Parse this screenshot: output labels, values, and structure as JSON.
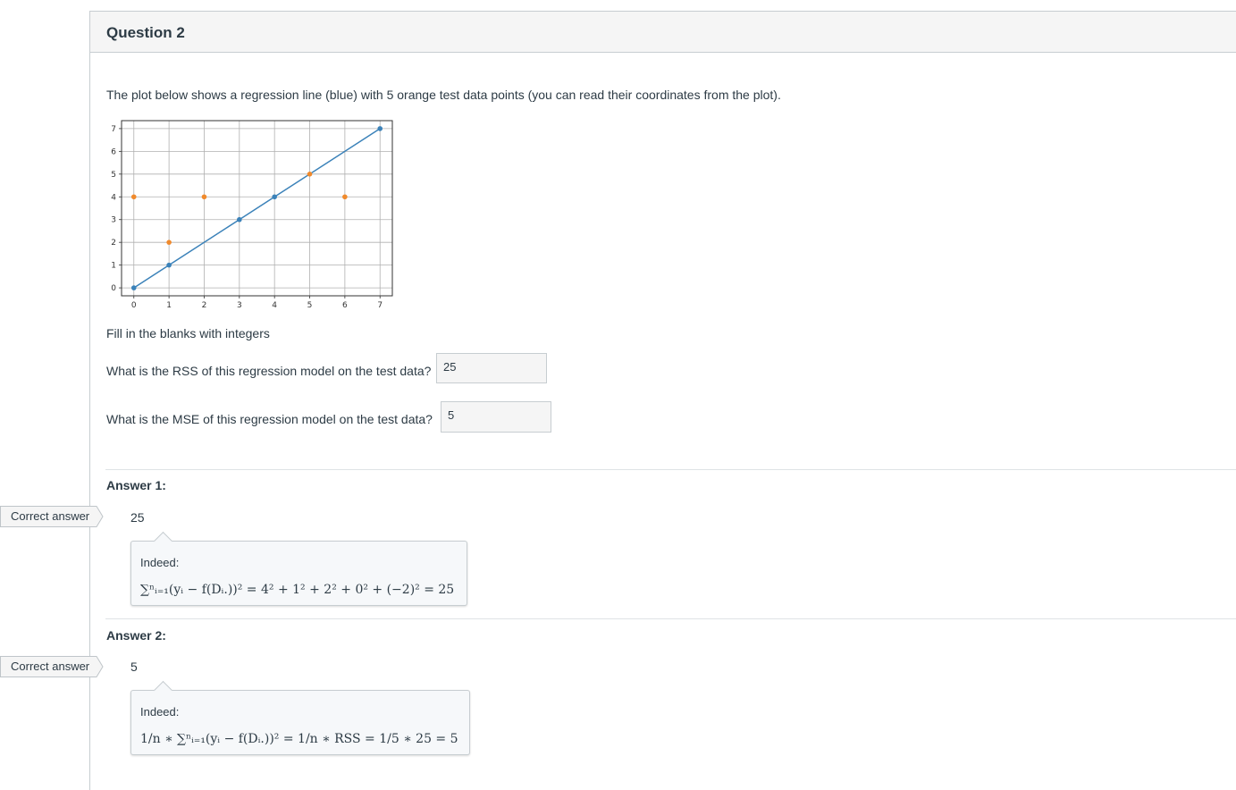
{
  "question": {
    "title": "Question 2",
    "prompt": "The plot below shows a regression line (blue) with 5 orange test data points (you can read their coordinates from the plot).",
    "instruction": "Fill in the blanks with integers",
    "blank1_label": "What is the RSS of this regression model on the test data?",
    "blank1_value": "25",
    "blank2_label": "What is the MSE of this regression model on the test data?",
    "blank2_value": "5"
  },
  "answers": [
    {
      "heading": "Answer 1:",
      "tag": "Correct answer",
      "value": "25",
      "comment_label": "Indeed:",
      "comment_math": "∑ⁿᵢ₌₁(yᵢ − f(Dᵢ.))² = 4² + 1² + 2² + 0² + (−2)² = 25"
    },
    {
      "heading": "Answer 2:",
      "tag": "Correct answer",
      "value": "5",
      "comment_label": "Indeed:",
      "comment_math": "1/n ∗ ∑ⁿᵢ₌₁(yᵢ − f(Dᵢ.))² = 1/n ∗ RSS = 1/5 ∗ 25 = 5"
    }
  ],
  "colors": {
    "line": "#3b82b9",
    "test_points": "#f08a2c"
  },
  "chart_data": {
    "type": "scatter",
    "title": "",
    "xlabel": "",
    "ylabel": "",
    "xlim": [
      -0.35,
      7.35
    ],
    "ylim": [
      -0.35,
      7.35
    ],
    "x_ticks": [
      0,
      1,
      2,
      3,
      4,
      5,
      6,
      7
    ],
    "y_ticks": [
      0,
      1,
      2,
      3,
      4,
      5,
      6,
      7
    ],
    "grid": true,
    "series": [
      {
        "role": "regression-line",
        "color": "#3b82b9",
        "points": [
          [
            0,
            0
          ],
          [
            1,
            1
          ],
          [
            3,
            3
          ],
          [
            4,
            4
          ],
          [
            7,
            7
          ]
        ]
      },
      {
        "role": "test-points",
        "color": "#f08a2c",
        "points": [
          [
            0,
            4
          ],
          [
            1,
            2
          ],
          [
            2,
            4
          ],
          [
            5,
            5
          ],
          [
            6,
            4
          ]
        ]
      }
    ]
  }
}
